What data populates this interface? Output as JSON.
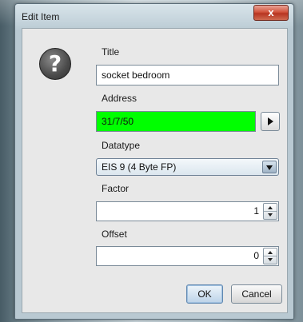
{
  "window": {
    "title": "Edit Item",
    "close_label": "x"
  },
  "icon": {
    "name": "question-icon",
    "glyph": "?"
  },
  "form": {
    "title_label": "Title",
    "title_value": "socket bedroom",
    "address_label": "Address",
    "address_value": "31/7/50",
    "address_bg_color": "#00ff00",
    "datatype_label": "Datatype",
    "datatype_value": "EIS 9 (4 Byte FP)",
    "factor_label": "Factor",
    "factor_value": "1",
    "offset_label": "Offset",
    "offset_value": "0"
  },
  "buttons": {
    "ok_label": "OK",
    "cancel_label": "Cancel"
  }
}
